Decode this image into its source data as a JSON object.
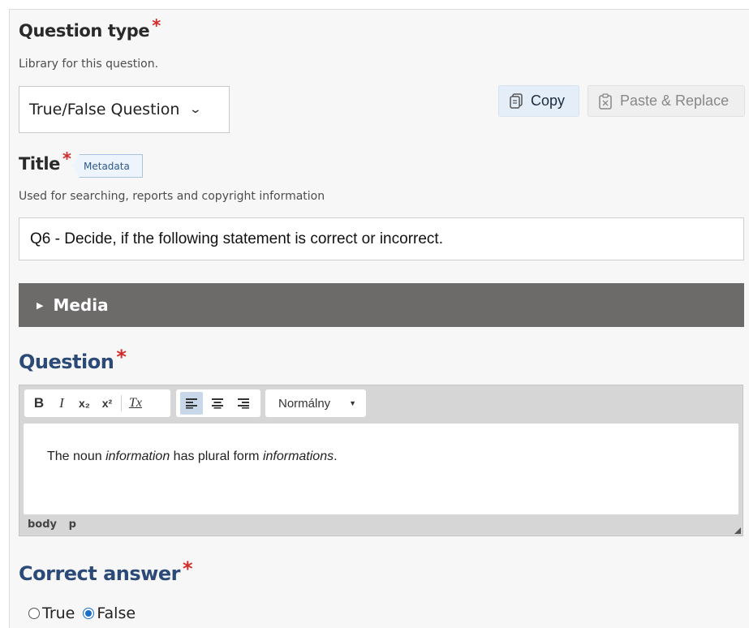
{
  "question_type": {
    "label": "Question type",
    "required_mark": "*",
    "description": "Library for this question.",
    "selected": "True/False Question"
  },
  "actions": {
    "copy_label": "Copy",
    "paste_label": "Paste & Replace"
  },
  "title_field": {
    "label": "Title",
    "required_mark": "*",
    "tag": "Metadata",
    "description": "Used for searching, reports and copyright information",
    "value": "Q6 - Decide, if the following statement is correct or incorrect."
  },
  "media": {
    "label": "Media"
  },
  "question": {
    "label": "Question",
    "required_mark": "*",
    "toolbar": {
      "bold": "B",
      "italic": "I",
      "subscript": "x₂",
      "superscript": "x²",
      "clear_format": "Tx",
      "format_select": "Normálny"
    },
    "content": {
      "part1": "The noun ",
      "part2": "information",
      "part3": " has plural form ",
      "part4": "informations",
      "part5": "."
    },
    "path": [
      "body",
      "p"
    ]
  },
  "correct_answer": {
    "label": "Correct answer",
    "required_mark": "*",
    "options": [
      "True",
      "False"
    ],
    "selected": "False"
  },
  "colors": {
    "accent_blue": "#2b4a78",
    "required_red": "#d22b2b",
    "media_bar": "#6d6a6a"
  }
}
